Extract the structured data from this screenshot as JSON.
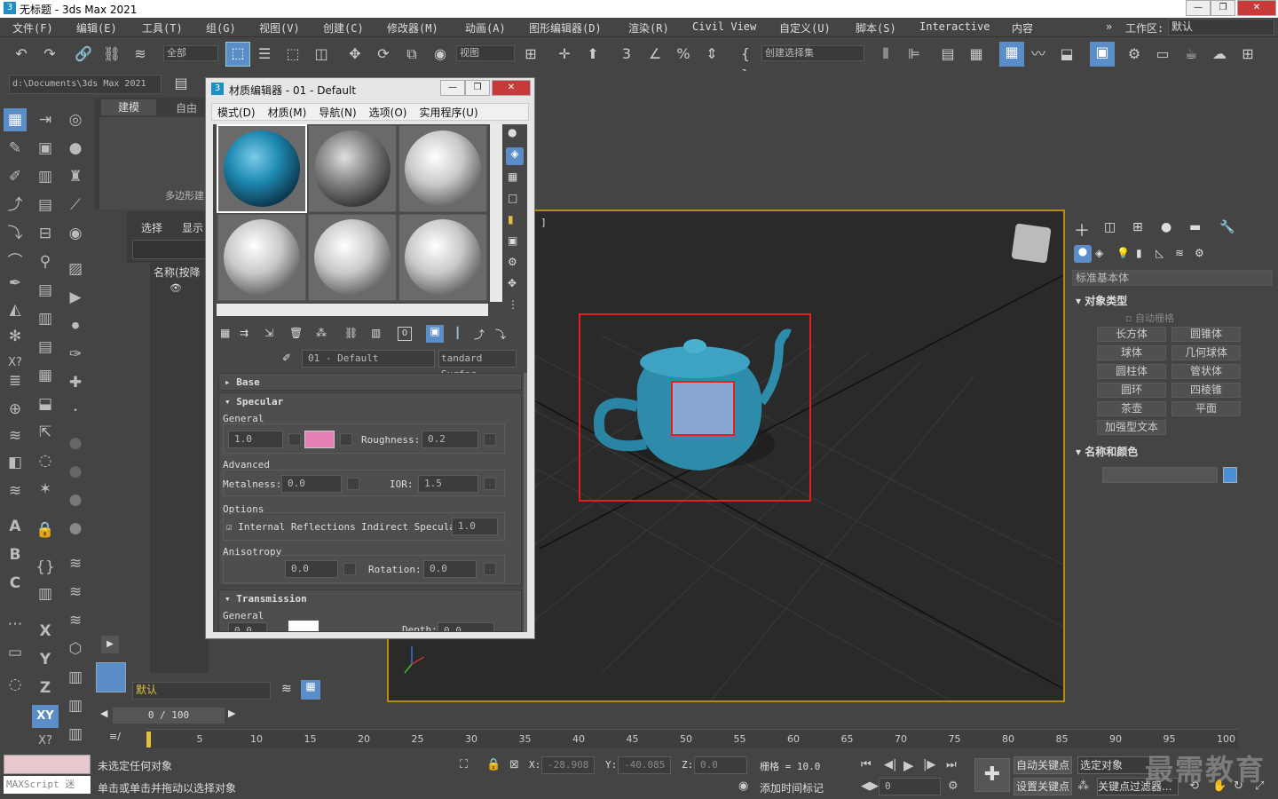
{
  "window": {
    "title": "无标题 - 3ds Max 2021"
  },
  "menu": [
    "文件(F)",
    "编辑(E)",
    "工具(T)",
    "组(G)",
    "视图(V)",
    "创建(C)",
    "修改器(M)",
    "动画(A)",
    "图形编辑器(D)",
    "渲染(R)",
    "Civil View",
    "自定义(U)",
    "脚本(S)",
    "Interactive",
    "内容"
  ],
  "workspace": {
    "label": "工作区:",
    "value": "默认"
  },
  "toolbar": {
    "filter": "全部",
    "view": "视图",
    "selset": "创建选择集"
  },
  "path": {
    "value": "d:\\Documents\\3ds Max 2021"
  },
  "ribbon": {
    "tab_active": "建模",
    "tab_other": "自由",
    "poly_label": "多边形建"
  },
  "scene_explorer": {
    "tab1": "选择",
    "tab2": "显示",
    "col_name": "名称(按降"
  },
  "mat_editor": {
    "title": "材质编辑器 - 01 - Default",
    "menus": [
      "模式(D)",
      "材质(M)",
      "导航(N)",
      "选项(O)",
      "实用程序(U)"
    ],
    "material_name": "01 - Default",
    "material_type": "tandard Surfac",
    "base": "Base",
    "specular": "Specular",
    "general": "General",
    "spec_weight": "1.0",
    "roughness_label": "Roughness:",
    "roughness": "0.2",
    "advanced": "Advanced",
    "metalness_label": "Metalness:",
    "metalness": "0.0",
    "ior_label": "IOR:",
    "ior": "1.5",
    "options": "Options",
    "internal_refl": "Internal Reflections",
    "indirect_spec": "Indirect Specular:",
    "indirect_spec_val": "1.0",
    "anisotropy": "Anisotropy",
    "aniso_val": "0.0",
    "rotation_label": "Rotation:",
    "rotation": "0.0",
    "transmission": "Transmission",
    "trans_general": "General",
    "trans_val": "0.0",
    "depth_label": "Depth:",
    "depth": "0.0",
    "spec_color": "#e57fb5"
  },
  "viewport": {
    "label": "]"
  },
  "command_panel": {
    "dropdown": "标准基本体",
    "object_type": "对象类型",
    "autogrid": "自动栅格",
    "buttons": [
      "长方体",
      "圆锥体",
      "球体",
      "几何球体",
      "圆柱体",
      "管状体",
      "圆环",
      "四棱锥",
      "茶壶",
      "平面",
      "加强型文本"
    ],
    "name_color": "名称和颜色",
    "swatch_color": "#4a90d9"
  },
  "layer": {
    "value": "默认"
  },
  "timeline": {
    "frame": "0 / 100",
    "ticks": [
      "0",
      "5",
      "10",
      "15",
      "20",
      "25",
      "30",
      "35",
      "40",
      "45",
      "50",
      "55",
      "60",
      "65",
      "70",
      "75",
      "80",
      "85",
      "90",
      "95",
      "100"
    ]
  },
  "status": {
    "line1": "未选定任何对象",
    "line2": "单击或单击并拖动以选择对象",
    "maxscript": "MAXScript 迷",
    "x_label": "X:",
    "x": "-28.908",
    "y_label": "Y:",
    "y": "-40.085",
    "z_label": "Z:",
    "z": "0.0",
    "grid": "栅格 = 10.0",
    "add_tag": "添加时间标记",
    "autokey": "自动关键点",
    "selected": "选定对象",
    "setkey": "设置关键点",
    "keyfilter": "关键点过滤器...",
    "frame_input": "0",
    "watermark": "最需教育"
  }
}
